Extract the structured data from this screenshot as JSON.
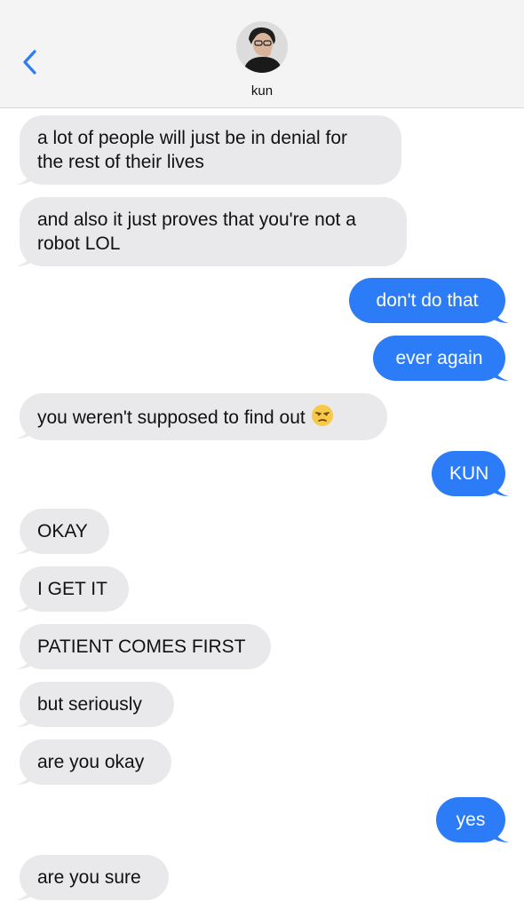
{
  "header": {
    "contact_name": "kun",
    "back_icon": "chevron-left-icon",
    "accent_color": "#2b7cf6"
  },
  "colors": {
    "incoming_bubble": "#e9e9eb",
    "outgoing_bubble": "#2b7cf6"
  },
  "messages": [
    {
      "direction": "in",
      "lines": [
        "a lot of people will just be in denial for",
        "the rest of their lives"
      ]
    },
    {
      "direction": "in",
      "lines": [
        "and also it just proves that you're not a",
        "robot LOL"
      ]
    },
    {
      "direction": "out",
      "text": "don't do that"
    },
    {
      "direction": "out",
      "text": "ever again"
    },
    {
      "direction": "in",
      "text": "you weren't supposed to find out",
      "emoji": "unamused-face-icon"
    },
    {
      "direction": "out",
      "text": "KUN"
    },
    {
      "direction": "in",
      "text": "OKAY"
    },
    {
      "direction": "in",
      "text": "I GET IT"
    },
    {
      "direction": "in",
      "text": "PATIENT COMES FIRST"
    },
    {
      "direction": "in",
      "text": "but seriously"
    },
    {
      "direction": "in",
      "text": "are you okay"
    },
    {
      "direction": "out",
      "text": "yes"
    },
    {
      "direction": "in",
      "text": "are you sure"
    }
  ]
}
